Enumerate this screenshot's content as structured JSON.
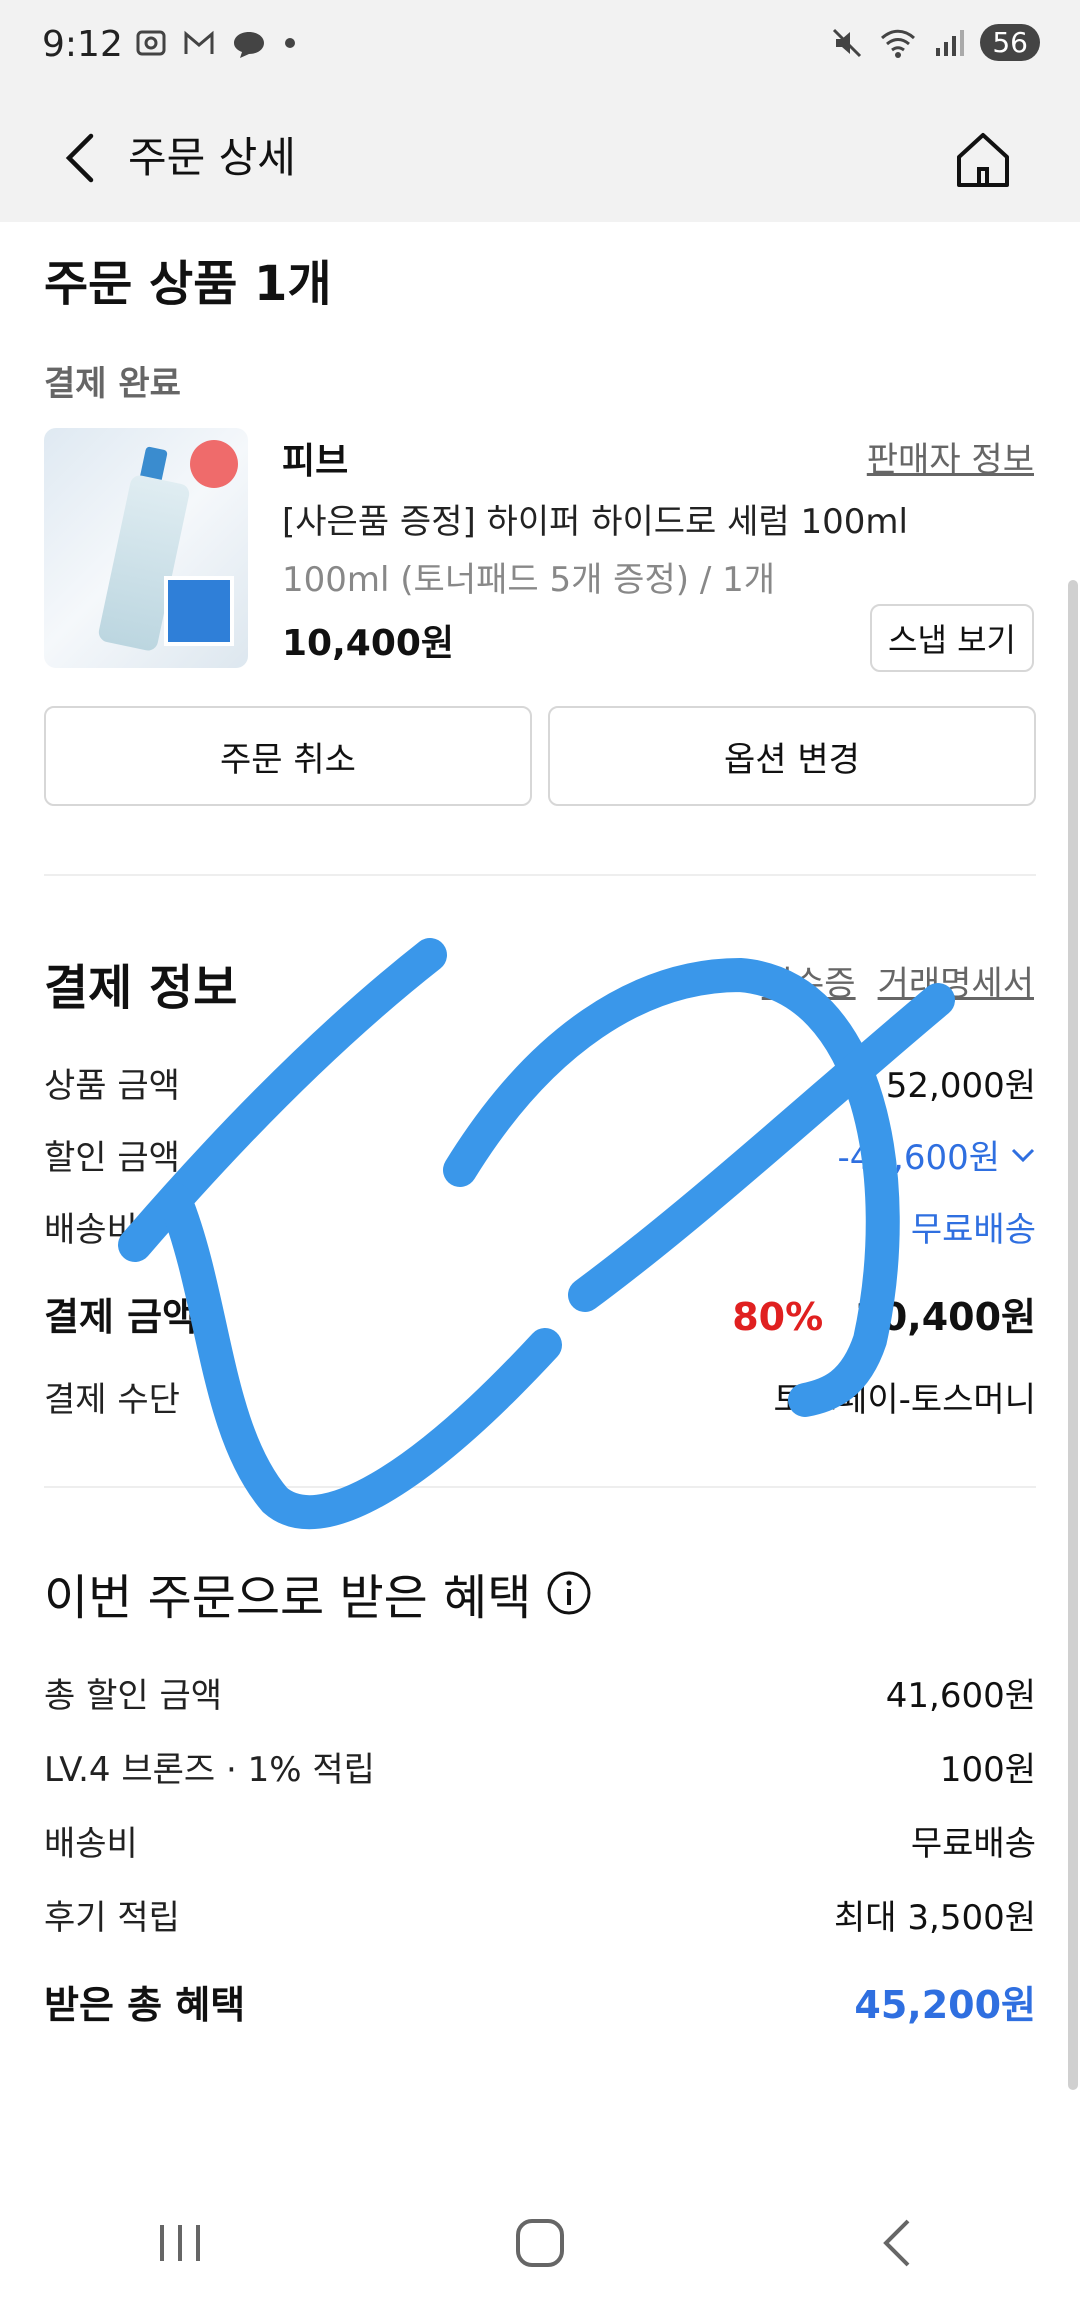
{
  "status_bar": {
    "time": "9:12",
    "battery": "56"
  },
  "app_bar": {
    "title": "주문 상세"
  },
  "order_items": {
    "heading": "주문 상품 1개",
    "status": "결제 완료",
    "product": {
      "brand": "피브",
      "seller_link": "판매자 정보",
      "name": "[사은품 증정] 하이퍼 하이드로 세럼 100ml",
      "option": "100ml (토너패드 5개 증정) / 1개",
      "price": "10,400원",
      "snap_button": "스냅 보기"
    },
    "cancel_button": "주문 취소",
    "change_option_button": "옵션 변경"
  },
  "payment": {
    "heading": "결제 정보",
    "receipt_link": "영수증",
    "statement_link": "거래명세서",
    "rows": [
      {
        "label": "상품 금액",
        "value": "52,000원"
      },
      {
        "label": "할인 금액",
        "value": "-41,600원"
      },
      {
        "label": "배송비",
        "value": "무료배송"
      },
      {
        "label": "결제 금액",
        "discount_rate": "80%",
        "value": "10,400원"
      },
      {
        "label": "결제 수단",
        "value": "토스페이-토스머니"
      }
    ]
  },
  "benefits": {
    "heading": "이번 주문으로 받은 혜택",
    "rows": [
      {
        "label": "총 할인 금액",
        "value": "41,600원"
      },
      {
        "label": "LV.4 브론즈 · 1% 적립",
        "value": "100원"
      },
      {
        "label": "배송비",
        "value": "무료배송"
      },
      {
        "label": "후기 적립",
        "value": "최대 3,500원"
      }
    ],
    "total_label": "받은 총 혜택",
    "total_value": "45,200원"
  },
  "colors": {
    "accent_blue": "#2f6fe0",
    "discount_red": "#e02020",
    "scribble_blue": "#3a97ea"
  }
}
